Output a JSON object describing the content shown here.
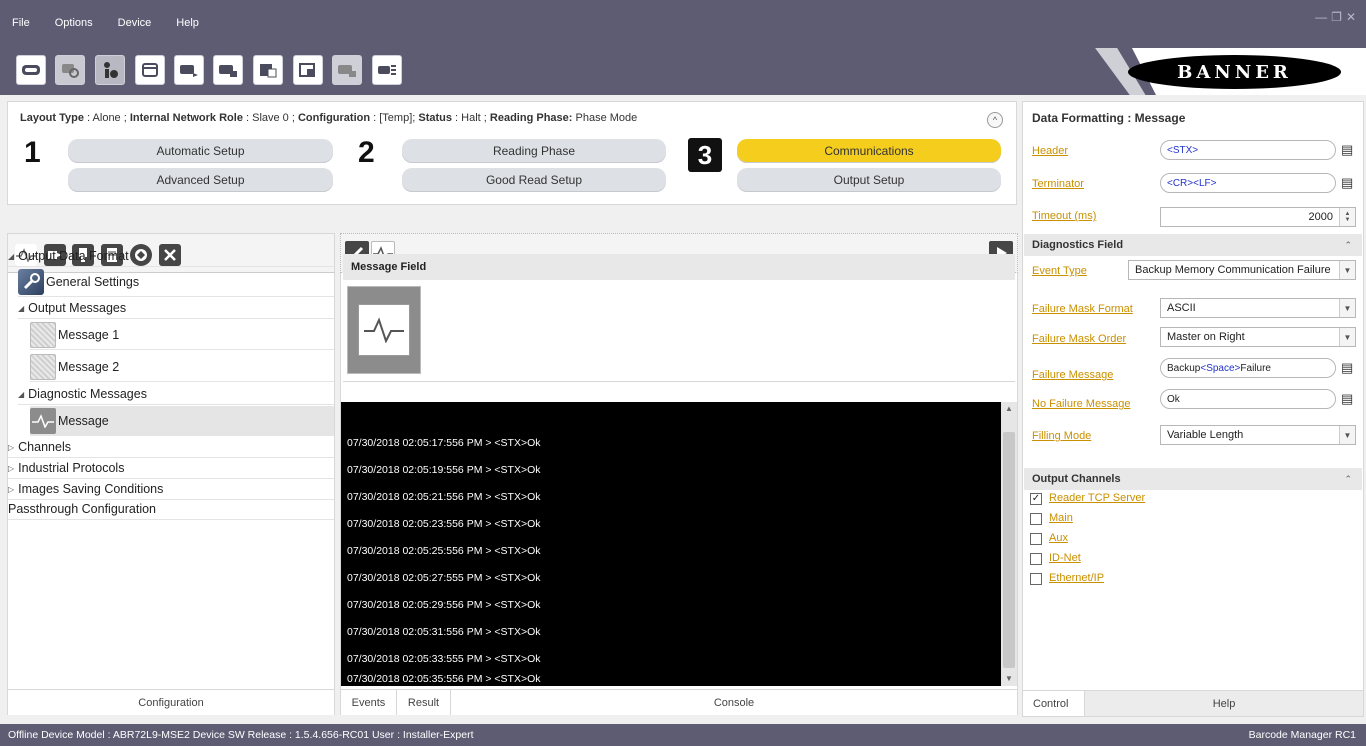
{
  "menu": [
    "File",
    "Options",
    "Device",
    "Help"
  ],
  "logo_text": "BANNER",
  "wizard": {
    "status": {
      "layout_type_label": "Layout Type",
      "layout_type_value": " : Alone ; ",
      "network_role_label": "Internal Network Role",
      "network_role_value": " : Slave 0 ; ",
      "configuration_label": "Configuration",
      "configuration_value": " : [Temp]; ",
      "status_label": "Status",
      "status_value": " : Halt ; ",
      "reading_phase_label": "Reading Phase:",
      "reading_phase_value": " Phase Mode"
    },
    "step1": "1",
    "step2": "2",
    "step3": "3",
    "automatic_setup": "Automatic Setup",
    "advanced_setup": "Advanced Setup",
    "reading_phase": "Reading Phase",
    "good_read_setup": "Good Read Setup",
    "communications": "Communications",
    "output_setup": "Output Setup",
    "collapse": "^"
  },
  "tree": {
    "output_data_format": "Output Data Format",
    "general_settings": "General Settings",
    "output_messages": "Output Messages",
    "message_1": "Message 1",
    "message_2": "Message 2",
    "diagnostic_messages": "Diagnostic Messages",
    "message": "Message",
    "channels": "Channels",
    "industrial_protocols": "Industrial Protocols",
    "images_saving_conditions": "Images Saving Conditions",
    "passthrough_configuration": "Passthrough Configuration"
  },
  "left_footer": "Configuration",
  "center": {
    "message_field_title": "Message Field",
    "log_lines": [
      "07/30/2018 02:05:17:556 PM > <STX>Ok",
      "07/30/2018 02:05:19:556 PM > <STX>Ok",
      "07/30/2018 02:05:21:556 PM > <STX>Ok",
      "07/30/2018 02:05:23:556 PM > <STX>Ok",
      "07/30/2018 02:05:25:556 PM > <STX>Ok",
      "07/30/2018 02:05:27:555 PM > <STX>Ok",
      "07/30/2018 02:05:29:556 PM > <STX>Ok",
      "07/30/2018 02:05:31:556 PM > <STX>Ok",
      "07/30/2018 02:05:33:555 PM > <STX>Ok",
      "07/30/2018 02:05:35:556 PM > <STX>Ok"
    ],
    "tab_events": "Events",
    "tab_result": "Result",
    "tab_console": "Console"
  },
  "right": {
    "title": "Data Formatting : Message",
    "header_label": "Header",
    "header_value": "<STX>",
    "terminator_label": "Terminator",
    "terminator_value": "<CR><LF>",
    "timeout_label": "Timeout (ms)",
    "timeout_value": "2000",
    "diagnostics_section": "Diagnostics Field",
    "event_type_label": "Event Type",
    "event_type_value": "Backup Memory Communication Failure",
    "failure_mask_format_label": "Failure Mask Format",
    "failure_mask_format_value": "ASCII",
    "failure_mask_order_label": "Failure Mask Order",
    "failure_mask_order_value": "Master on Right",
    "failure_message_label": "Failure Message",
    "failure_message_value_a": "Backup",
    "failure_message_value_b": "<Space>",
    "failure_message_value_c": "Failure",
    "no_failure_message_label": "No Failure Message",
    "no_failure_message_value": "Ok",
    "filling_mode_label": "Filling Mode",
    "filling_mode_value": "Variable Length",
    "output_channels_section": "Output Channels",
    "channels": [
      {
        "label": "Reader TCP Server",
        "checked": "✓"
      },
      {
        "label": "Main",
        "checked": ""
      },
      {
        "label": "Aux",
        "checked": ""
      },
      {
        "label": "ID-Net",
        "checked": ""
      },
      {
        "label": "Ethernet/IP",
        "checked": ""
      }
    ],
    "tab_control": "Control",
    "tab_help": "Help"
  },
  "statusbar": {
    "text": "Offline Device Model : ABR72L9-MSE2   Device SW Release : 1.5.4.656-RC01   User : Installer-Expert",
    "right": "Barcode Manager RC1"
  },
  "colors": {
    "chrome": "#5d5c73",
    "accent_yellow": "#f4cd1d",
    "link_gold": "#c99000"
  }
}
